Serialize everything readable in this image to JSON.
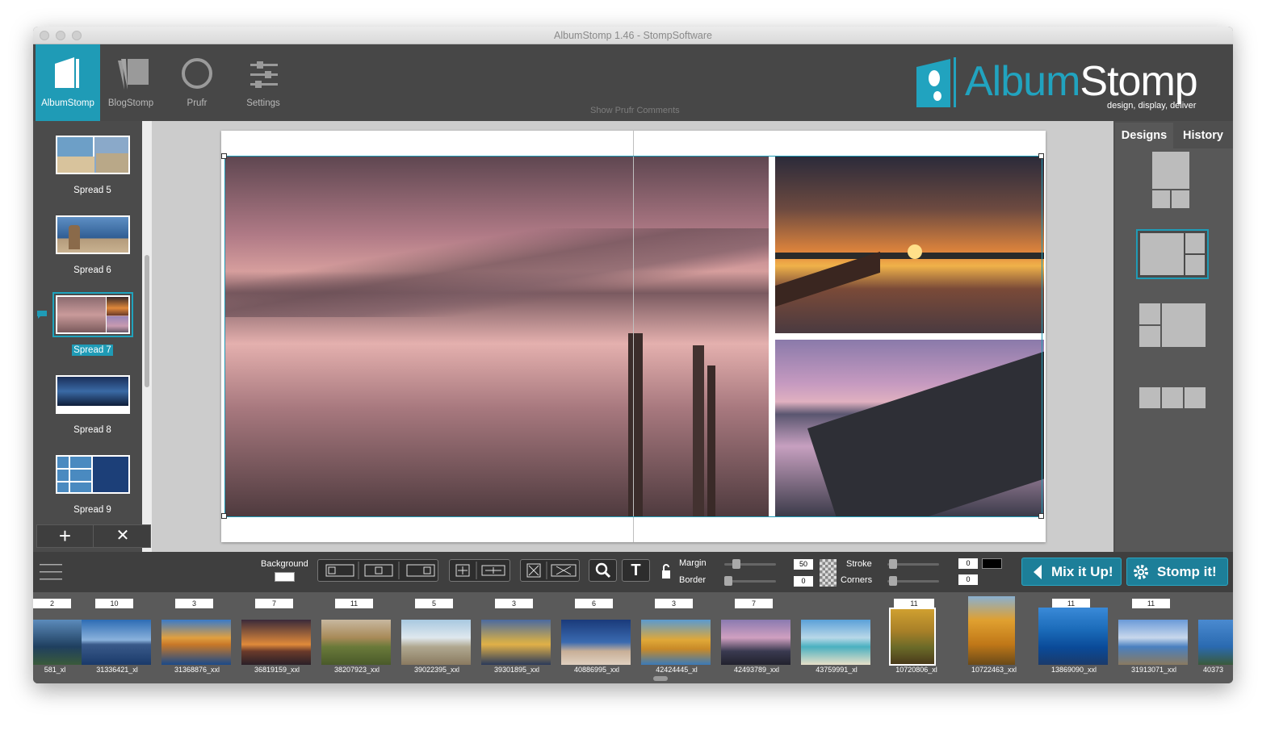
{
  "window": {
    "title": "AlbumStomp 1.46 - StompSoftware"
  },
  "modules": [
    {
      "label": "AlbumStomp",
      "icon": "album-icon"
    },
    {
      "label": "BlogStomp",
      "icon": "blog-icon"
    },
    {
      "label": "Prufr",
      "icon": "prufr-icon"
    },
    {
      "label": "Settings",
      "icon": "settings-icon"
    }
  ],
  "header": {
    "prufr_link": "Show Prufr Comments",
    "logo_album": "Album",
    "logo_stomp": "Stomp",
    "logo_tagline": "design, display, deliver"
  },
  "spreads": [
    {
      "label": "Spread 5",
      "selected": false
    },
    {
      "label": "Spread 6",
      "selected": false
    },
    {
      "label": "Spread 7",
      "selected": true
    },
    {
      "label": "Spread 8",
      "selected": false
    },
    {
      "label": "Spread 9",
      "selected": false
    }
  ],
  "spread_buttons": {
    "add": "+",
    "remove": "✕"
  },
  "right_tabs": {
    "designs": "Designs",
    "history": "History"
  },
  "toolbar": {
    "background_label": "Background",
    "margin_label": "Margin",
    "margin_value": "50",
    "border_label": "Border",
    "border_value": "0",
    "stroke_label": "Stroke",
    "stroke_value": "0",
    "corners_label": "Corners",
    "corners_value": "0",
    "text_tool": "T",
    "mix_label": "Mix it Up!",
    "stomp_label": "Stomp it!"
  },
  "filmstrip": [
    {
      "count": "2",
      "name": "581_xl"
    },
    {
      "count": "10",
      "name": "31336421_xl"
    },
    {
      "count": "3",
      "name": "31368876_xxl"
    },
    {
      "count": "7",
      "name": "36819159_xxl"
    },
    {
      "count": "11",
      "name": "38207923_xxl"
    },
    {
      "count": "5",
      "name": "39022395_xxl"
    },
    {
      "count": "3",
      "name": "39301895_xxl"
    },
    {
      "count": "6",
      "name": "40886995_xxl"
    },
    {
      "count": "3",
      "name": "42424445_xl"
    },
    {
      "count": "7",
      "name": "42493789_xxl"
    },
    {
      "count": "",
      "name": "43759991_xl"
    },
    {
      "count": "11",
      "name": "10720806_xl"
    },
    {
      "count": "",
      "name": "10722463_xxl"
    },
    {
      "count": "11",
      "name": "13869090_xxl"
    },
    {
      "count": "11",
      "name": "31913071_xxl"
    },
    {
      "count": "",
      "name": "40373"
    }
  ],
  "colors": {
    "accent": "#1f9bb6",
    "toolbar_bg": "#3f3f3f",
    "canvas_bg": "#cccccc"
  }
}
